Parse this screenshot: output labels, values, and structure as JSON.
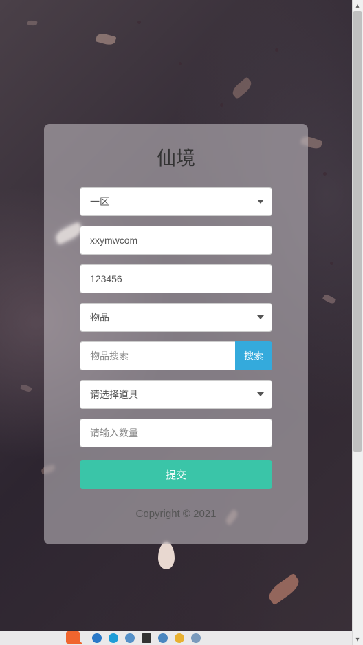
{
  "card": {
    "title": "仙境",
    "zone_selected": "一区",
    "account_value": "xxymwcom",
    "password_value": "123456",
    "category_selected": "物品",
    "search_placeholder": "物品搜索",
    "search_button": "搜索",
    "item_selected": "请选择道具",
    "quantity_placeholder": "请输入数量",
    "submit_button": "提交",
    "copyright": "Copyright © 2021"
  }
}
